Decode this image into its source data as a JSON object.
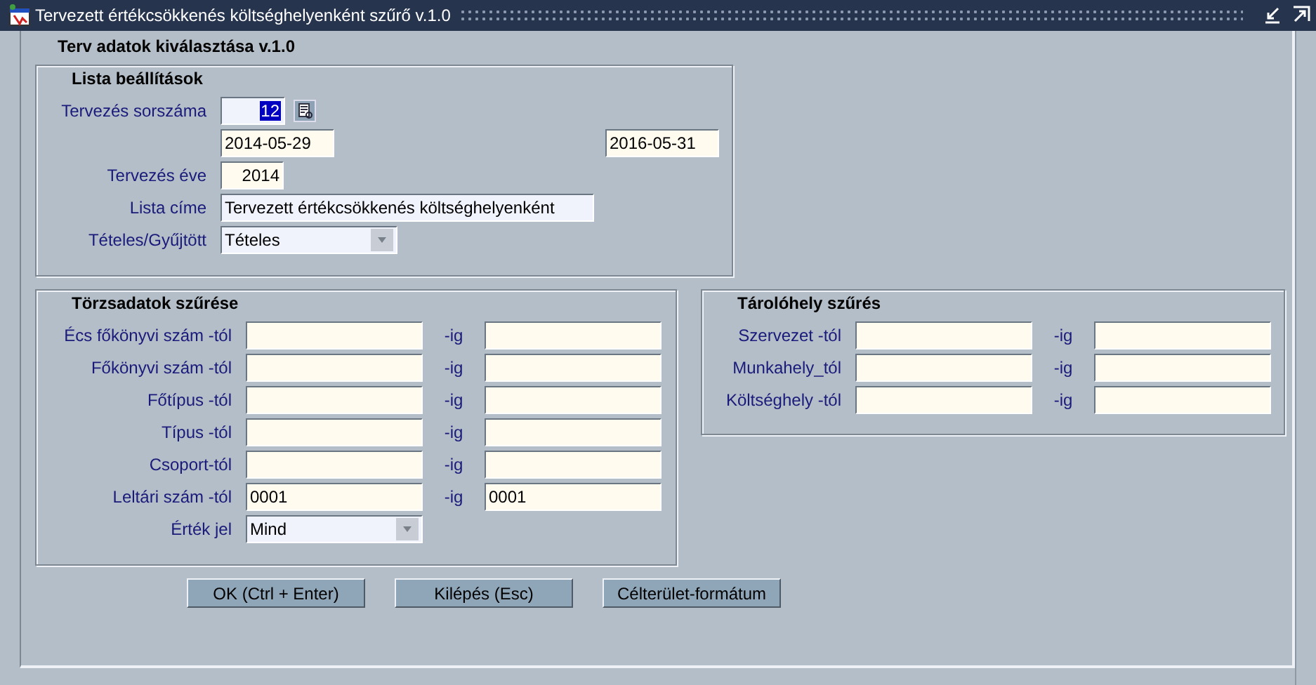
{
  "window": {
    "title": "Tervezett értékcsökkenés költséghelyenként szűrő v.1.0"
  },
  "form_title": "Terv adatok kiválasztása v.1.0",
  "lista": {
    "title": "Lista beállítások",
    "rows": [
      {
        "kind": "lookup",
        "label": "Tervezés sorszáma",
        "value": "12",
        "selected": true
      },
      {
        "kind": "daterange",
        "from": "2014-05-29",
        "to": "2016-05-31"
      },
      {
        "kind": "short",
        "label": "Tervezés éve",
        "value": "2014"
      },
      {
        "kind": "text",
        "label": "Lista címe",
        "value": "Tervezett értékcsökkenés költséghelyenként"
      },
      {
        "kind": "dropdown",
        "label": "Tételes/Gyűjtött",
        "value": "Tételes"
      }
    ]
  },
  "torzs": {
    "title": "Törzsadatok szűrése",
    "rows": [
      {
        "kind": "range",
        "label": "Écs főkönyvi szám -tól",
        "sep": "-ig"
      },
      {
        "kind": "range",
        "label": "Főkönyvi szám -tól",
        "sep": "-ig"
      },
      {
        "kind": "range",
        "label": "Főtípus -tól",
        "sep": "-ig"
      },
      {
        "kind": "range",
        "label": "Típus -tól",
        "sep": "-ig"
      },
      {
        "kind": "range",
        "label": "Csoport-tól",
        "sep": "-ig"
      },
      {
        "kind": "range",
        "label": "Leltári szám -tól",
        "sep": "-ig",
        "from": "0001",
        "to": "0001"
      },
      {
        "kind": "dropdown",
        "label": "Érték jel",
        "value": "Mind"
      }
    ]
  },
  "tarolo": {
    "title": "Tárolóhely szűrés",
    "rows": [
      {
        "kind": "range",
        "label": "Szervezet -tól",
        "sep": "-ig"
      },
      {
        "kind": "range",
        "label": "Munkahely_tól",
        "sep": "-ig"
      },
      {
        "kind": "range",
        "label": "Költséghely -tól",
        "sep": "-ig"
      }
    ]
  },
  "buttons": [
    "OK (Ctrl + Enter)",
    "Kilépés (Esc)",
    "Célterület-formátum"
  ]
}
